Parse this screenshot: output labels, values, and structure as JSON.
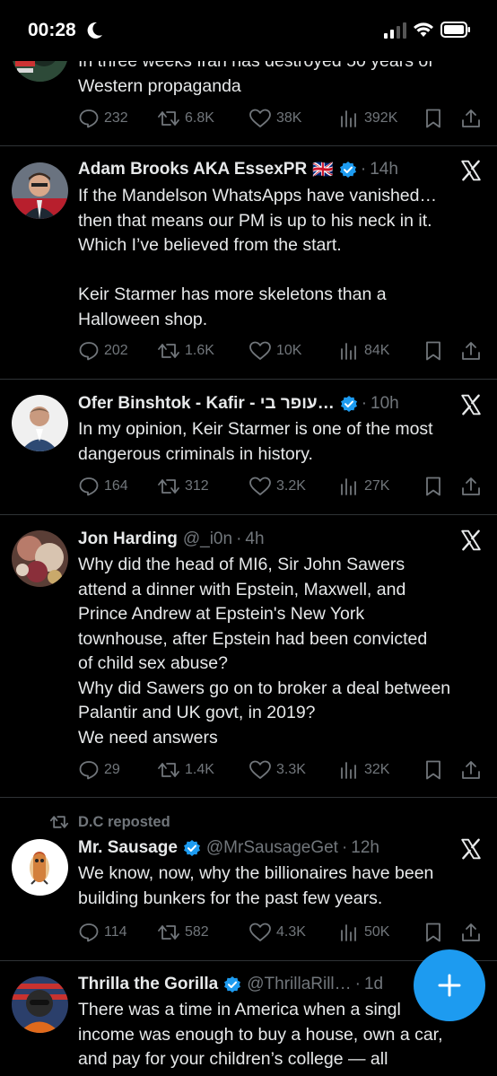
{
  "status_bar": {
    "time": "00:28"
  },
  "colors": {
    "accent": "#1d9bf0",
    "background": "#000000",
    "muted": "#71767b",
    "text": "#e7e9ea"
  },
  "tweets": [
    {
      "body": "In three weeks Iran has destroyed 50 years of\nWestern propaganda",
      "stats": {
        "replies": "232",
        "reposts": "6.8K",
        "likes": "38K",
        "views": "392K"
      }
    },
    {
      "name": "Adam Brooks AKA EssexPR",
      "flag": "🇬🇧",
      "time": "14h",
      "body": "If the Mandelson WhatsApps have vanished…\nthen that means our PM is up to his neck in it.\nWhich I’ve believed from the start.\n\nKeir Starmer has more skeletons than a\nHalloween shop.",
      "stats": {
        "replies": "202",
        "reposts": "1.6K",
        "likes": "10K",
        "views": "84K"
      }
    },
    {
      "name": "Ofer Binshtok - Kafir - עופר בי…",
      "time": "10h",
      "body": "In my opinion, Keir Starmer is one of the most\ndangerous criminals in history.",
      "stats": {
        "replies": "164",
        "reposts": "312",
        "likes": "3.2K",
        "views": "27K"
      }
    },
    {
      "name": "Jon Harding",
      "handle": "@_i0n",
      "time": "4h",
      "body": "Why did the head of MI6, Sir John Sawers\nattend a dinner with Epstein, Maxwell, and\nPrince Andrew at Epstein's New York\ntownhouse, after Epstein had been convicted\nof child sex abuse?\nWhy did Sawers go on to broker a deal between\nPalantir and UK govt, in 2019?\nWe need answers",
      "stats": {
        "replies": "29",
        "reposts": "1.4K",
        "likes": "3.3K",
        "views": "32K"
      }
    },
    {
      "repost_label": "D.C reposted",
      "name": "Mr. Sausage",
      "handle": "@MrSausageGet",
      "time": "12h",
      "body": "We know, now, why the billionaires have been\nbuilding bunkers for the past few years.",
      "stats": {
        "replies": "114",
        "reposts": "582",
        "likes": "4.3K",
        "views": "50K"
      }
    },
    {
      "name": "Thrilla the Gorilla",
      "handle": "@ThrillaRill…",
      "time": "1d",
      "body": "There was a time in America when a singl\nincome was enough to buy a house, own a car,\nand pay for your children’s college — all"
    }
  ],
  "fab": {
    "icon": "plus-icon"
  }
}
